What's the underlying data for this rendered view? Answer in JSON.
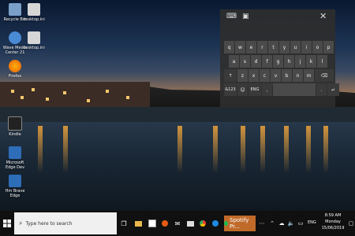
{
  "desktop": {
    "icons": [
      {
        "label": "Recycle Bin",
        "icon": "recycle-bin-icon"
      },
      {
        "label": "desktop.ini",
        "icon": "file-icon"
      },
      {
        "label": "Wave Media Center 21",
        "icon": "media-center-icon"
      },
      {
        "label": "desktop.ini",
        "icon": "file-icon"
      },
      {
        "label": "Firefox",
        "icon": "firefox-icon"
      },
      {
        "label": "Kindle",
        "icon": "kindle-icon"
      },
      {
        "label": "Microsoft Edge Dev",
        "icon": "edge-dev-icon"
      },
      {
        "label": "Hm Brave Edge",
        "icon": "edge-beta-icon"
      }
    ]
  },
  "keyboard": {
    "row1": [
      "q",
      "w",
      "e",
      "r",
      "t",
      "y",
      "u",
      "i",
      "o",
      "p"
    ],
    "row2": [
      "a",
      "s",
      "d",
      "f",
      "g",
      "h",
      "j",
      "k",
      "l"
    ],
    "row3_shift": "↑",
    "row3": [
      "z",
      "x",
      "c",
      "v",
      "b",
      "n",
      "m"
    ],
    "row3_backspace": "⌫",
    "row4_symbols": "&123",
    "row4_emoji": "☺",
    "row4_lang": "ENG",
    "row4_comma": ",",
    "row4_period": ".",
    "row4_enter": "↵"
  },
  "taskbar": {
    "search_placeholder": "Type here to search",
    "spotify_label": "Spotify Pr...",
    "tray": {
      "lang": "ENG",
      "time": "8:59 AM",
      "day": "Monday",
      "date": "15/06/2019"
    }
  }
}
